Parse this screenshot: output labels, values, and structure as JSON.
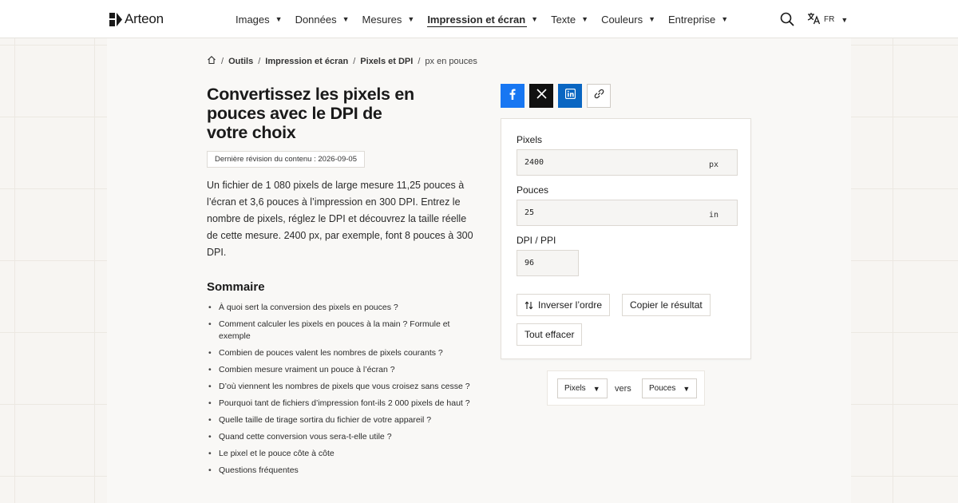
{
  "header": {
    "brand": "Arteon",
    "nav": [
      {
        "label": "Images",
        "active": false
      },
      {
        "label": "Données",
        "active": false
      },
      {
        "label": "Mesures",
        "active": false
      },
      {
        "label": "Impression et écran",
        "active": true
      },
      {
        "label": "Texte",
        "active": false
      },
      {
        "label": "Couleurs",
        "active": false
      },
      {
        "label": "Entreprise",
        "active": false
      }
    ],
    "search_icon": "search-icon",
    "language_code": "FR",
    "language_icon": "translate-icon"
  },
  "breadcrumb": {
    "home_icon": "home-icon",
    "items": [
      "Outils",
      "Impression et écran",
      "Pixels et DPI"
    ],
    "current": "px en pouces"
  },
  "article": {
    "title": "Convertissez les pixels en pouces avec le DPI de votre choix",
    "revision": "Dernière révision du contenu : 2026-09-05",
    "intro": "Un fichier de 1 080 pixels de large mesure 11,25 pouces à l’écran et 3,6 pouces à l’impression en 300 DPI. Entrez le nombre de pixels, réglez le DPI et découvrez la taille réelle de cette mesure. 2400 px, par exemple, font 8 pouces à 300 DPI.",
    "toc_title": "Sommaire",
    "toc": [
      "À quoi sert la conversion des pixels en pouces ?",
      "Comment calculer les pixels en pouces à la main ? Formule et exemple",
      "Combien de pouces valent les nombres de pixels courants ?",
      "Combien mesure vraiment un pouce à l’écran ?",
      "D’où viennent les nombres de pixels que vous croisez sans cesse ?",
      "Pourquoi tant de fichiers d’impression font-ils 2 000 pixels de haut ?",
      "Quelle taille de tirage sortira du fichier de votre appareil ?",
      "Quand cette conversion vous sera-t-elle utile ?",
      "Le pixel et le pouce côte à côte",
      "Questions fréquentes"
    ]
  },
  "share": {
    "facebook_icon": "facebook-icon",
    "x_icon": "x-icon",
    "linkedin_icon": "linkedin-icon",
    "link_icon": "link-icon"
  },
  "converter": {
    "pixels_label": "Pixels",
    "pixels_value": "2400",
    "pixels_unit": "px",
    "inches_label": "Pouces",
    "inches_value": "25",
    "inches_unit": "in",
    "dpi_label": "DPI / PPI",
    "dpi_value": "96",
    "swap_label": "Inverser l’ordre",
    "copy_label": "Copier le résultat",
    "clear_label": "Tout effacer"
  },
  "unit_selector": {
    "from": "Pixels",
    "connector": "vers",
    "to": "Pouces"
  },
  "colors": {
    "facebook": "#1877f2",
    "x": "#111111",
    "linkedin": "#0a66c2",
    "page_background": "#f7f5f2",
    "card_background": "#f9f8f6"
  }
}
